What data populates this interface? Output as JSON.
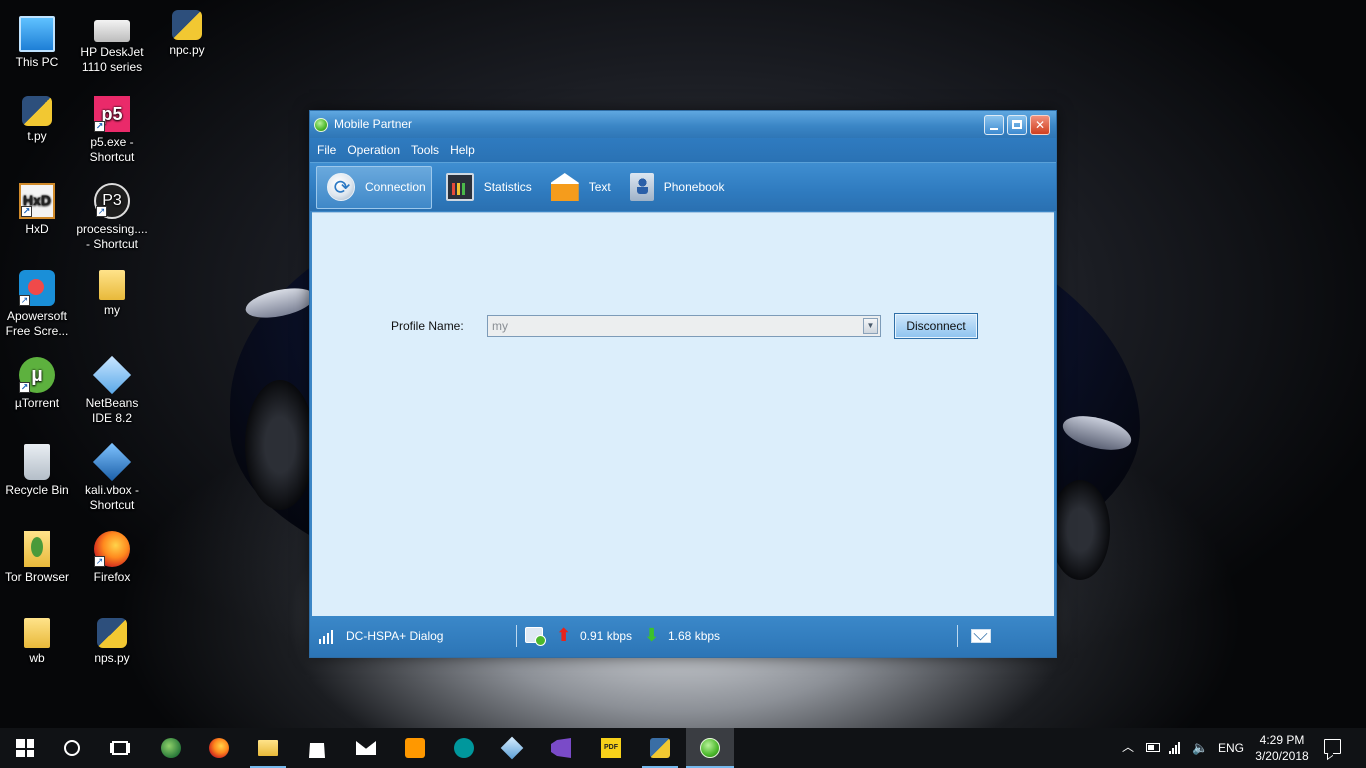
{
  "desktop": {
    "icons": [
      {
        "label": "This PC",
        "icon": "computer-icon"
      },
      {
        "label": "HP DeskJet 1110 series",
        "icon": "printer-icon"
      },
      {
        "label": "npc.py",
        "icon": "python-file-icon"
      },
      {
        "label": "t.py",
        "icon": "python-file-icon"
      },
      {
        "label": "p5.exe - Shortcut",
        "icon": "p5-app-icon"
      },
      {
        "label": "HxD",
        "icon": "hxd-app-icon"
      },
      {
        "label": "processing.... - Shortcut",
        "icon": "processing-app-icon"
      },
      {
        "label": "Apowersoft Free Scre...",
        "icon": "apowersoft-app-icon"
      },
      {
        "label": "my",
        "icon": "folder-icon"
      },
      {
        "label": "µTorrent",
        "icon": "utorrent-app-icon"
      },
      {
        "label": "NetBeans IDE 8.2",
        "icon": "netbeans-app-icon"
      },
      {
        "label": "Recycle Bin",
        "icon": "recycle-bin-icon"
      },
      {
        "label": "kali.vbox - Shortcut",
        "icon": "virtualbox-file-icon"
      },
      {
        "label": "Tor Browser",
        "icon": "tor-browser-icon"
      },
      {
        "label": "Firefox",
        "icon": "firefox-icon"
      },
      {
        "label": "wb",
        "icon": "folder-icon"
      },
      {
        "label": "nps.py",
        "icon": "python-file-icon"
      }
    ]
  },
  "window": {
    "title": "Mobile Partner",
    "menu": [
      "File",
      "Operation",
      "Tools",
      "Help"
    ],
    "tabs": [
      {
        "label": "Connection",
        "icon": "connection-icon",
        "active": true
      },
      {
        "label": "Statistics",
        "icon": "statistics-icon",
        "active": false
      },
      {
        "label": "Text",
        "icon": "text-message-icon",
        "active": false
      },
      {
        "label": "Phonebook",
        "icon": "phonebook-icon",
        "active": false
      }
    ],
    "connection": {
      "profile_label": "Profile Name:",
      "profile_value": "my",
      "disconnect_label": "Disconnect"
    },
    "status": {
      "network": "DC-HSPA+ Dialog",
      "upload": "0.91 kbps",
      "download": "1.68 kbps"
    }
  },
  "taskbar": {
    "apps": [
      "start",
      "search",
      "task-view",
      "browser-globe",
      "firefox",
      "file-explorer",
      "store",
      "mail",
      "sublime-text",
      "arduino",
      "virtualbox",
      "visual-studio",
      "pdf-reader",
      "python",
      "mobile-partner"
    ],
    "language": "ENG",
    "time": "4:29 PM",
    "date": "3/20/2018"
  },
  "colors": {
    "window_blue": "#3c86c6",
    "content_bg": "#dceefb",
    "taskbar_bg": "#101215",
    "accent": "#76b9ed"
  }
}
